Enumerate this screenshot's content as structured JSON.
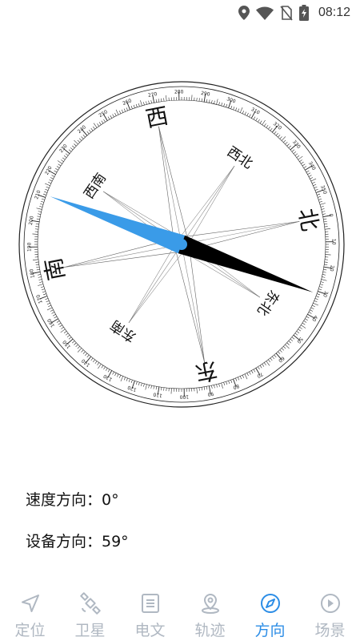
{
  "status_bar": {
    "time": "08:12",
    "icons": [
      "location-icon",
      "wifi-icon",
      "no-sim-icon",
      "battery-charging-icon"
    ]
  },
  "compass": {
    "heading_degrees": 59,
    "tick_labels": [
      "0",
      "10",
      "20",
      "30",
      "40",
      "50",
      "60",
      "70",
      "80",
      "90",
      "100",
      "110",
      "120",
      "130",
      "140",
      "150",
      "160",
      "170",
      "180",
      "190",
      "200",
      "210",
      "220",
      "230",
      "240",
      "250",
      "260",
      "270",
      "280",
      "290",
      "300",
      "310",
      "320",
      "330",
      "340",
      "350"
    ],
    "directions": {
      "north": "北",
      "northeast": "东北",
      "east": "东",
      "southeast": "东南",
      "south": "南",
      "southwest": "西南",
      "west": "西",
      "northwest": "西北"
    },
    "colors": {
      "needle_north": "#3a9be8",
      "needle_south": "#000000"
    }
  },
  "info": {
    "speed_direction": "速度方向：0°",
    "device_direction": "设备方向：59°"
  },
  "nav": {
    "active": "direction",
    "accent": "#2c8de6",
    "inactive_color": "#b0b8c2",
    "items": [
      {
        "key": "location",
        "label": "定位",
        "icon": "navigation-arrow-icon"
      },
      {
        "key": "satellite",
        "label": "卫星",
        "icon": "satellite-icon"
      },
      {
        "key": "telegram",
        "label": "电文",
        "icon": "document-icon"
      },
      {
        "key": "track",
        "label": "轨迹",
        "icon": "map-pin-icon"
      },
      {
        "key": "direction",
        "label": "方向",
        "icon": "compass-icon"
      },
      {
        "key": "scene",
        "label": "场景",
        "icon": "play-circle-icon"
      }
    ]
  }
}
